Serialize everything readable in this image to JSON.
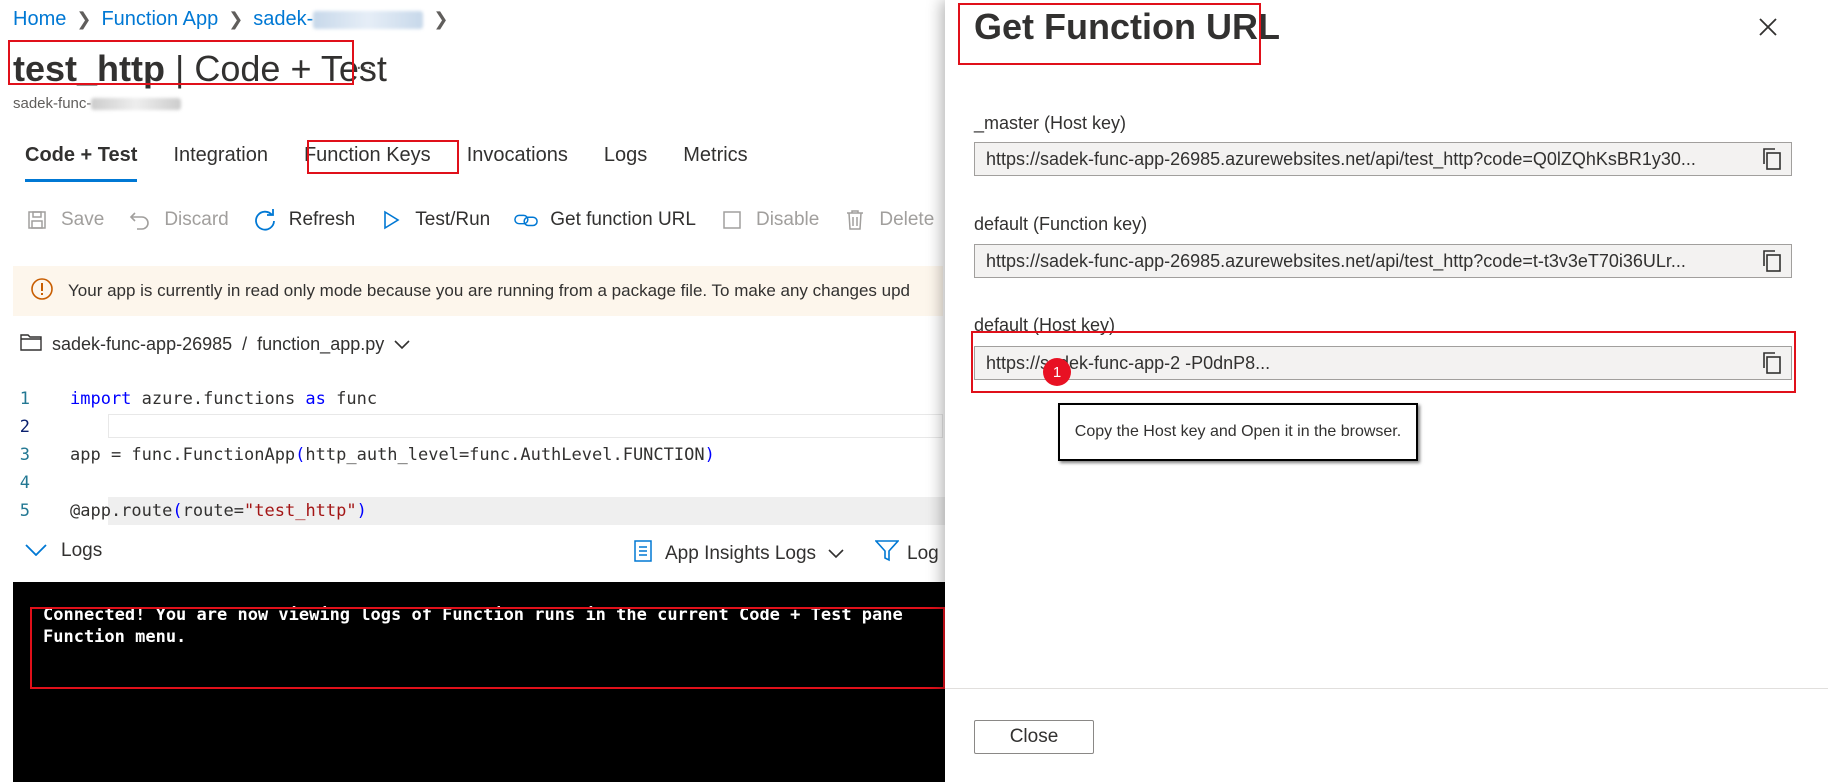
{
  "breadcrumb": {
    "items": [
      "Home",
      "Function App",
      "sadek-"
    ]
  },
  "header": {
    "function_name": "test_http",
    "divider": "|",
    "page": "Code + Test",
    "more": "...",
    "subtitle": "sadek-func-"
  },
  "tabs": [
    "Code + Test",
    "Integration",
    "Function Keys",
    "Invocations",
    "Logs",
    "Metrics"
  ],
  "toolbar": {
    "save": "Save",
    "discard": "Discard",
    "refresh": "Refresh",
    "test_run": "Test/Run",
    "get_url": "Get function URL",
    "disable": "Disable",
    "delete": "Delete"
  },
  "warning": "Your app is currently in read only mode because you are running from a package file. To make any changes upd",
  "file_path": {
    "app": "sadek-func-app-26985",
    "sep": "/",
    "file": "function_app.py"
  },
  "code_lines": [
    {
      "n": "1",
      "t1": "import",
      "t2": " azure.functions ",
      "t3": "as",
      "t4": " func"
    },
    {
      "n": "2",
      "text": ""
    },
    {
      "n": "3",
      "a": "app = func.FunctionApp",
      "b": "(",
      "c": "http_auth_level=func.AuthLevel.FUNCTION",
      "d": ")"
    },
    {
      "n": "4",
      "text": ""
    },
    {
      "n": "5",
      "a": "@app.route",
      "b": "(",
      "c": "route=",
      "s": "\"test_http\"",
      "d": ")"
    }
  ],
  "logs_bar": {
    "label": "Logs",
    "insights": "App Insights Logs",
    "filter": "Log"
  },
  "console_text": "Connected! You are now viewing logs of Function runs in the current Code + Test pane\nFunction menu.",
  "panel": {
    "title": "Get Function URL",
    "fields": [
      {
        "label": "_master (Host key)",
        "value": "https://sadek-func-app-26985.azurewebsites.net/api/test_http?code=Q0lZQhKsBR1y30..."
      },
      {
        "label": "default (Function key)",
        "value": "https://sadek-func-app-26985.azurewebsites.net/api/test_http?code=t-t3v3eT70i36ULr..."
      },
      {
        "label": "default (Host key)",
        "value": "https://sadek-func-app-2                                        -P0dnP8..."
      }
    ],
    "callout": "Copy the Host key and Open it in the browser.",
    "badge": "1",
    "close_button": "Close"
  },
  "colors": {
    "accent": "#0078d4",
    "annotation_red": "#e0101a",
    "warning_icon": "#c85d00"
  }
}
